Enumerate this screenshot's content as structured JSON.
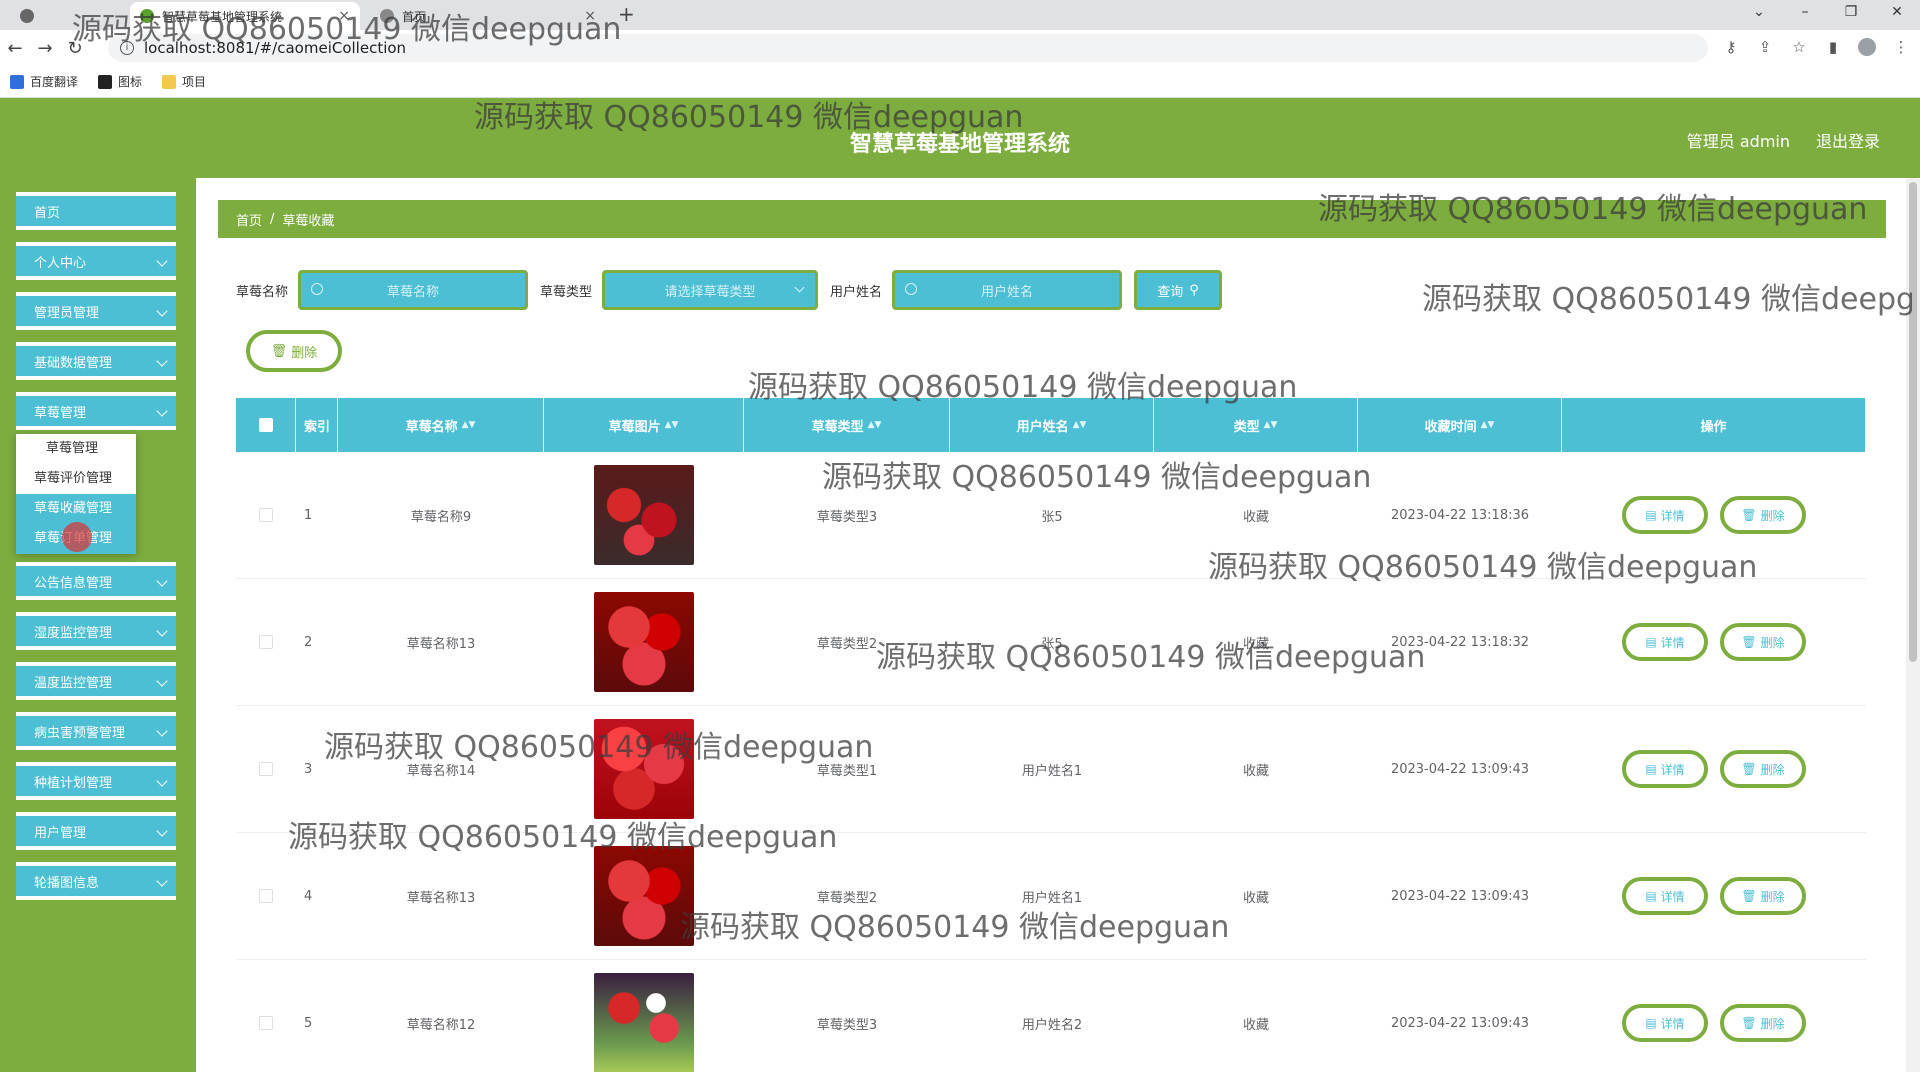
{
  "browser": {
    "tabs": [
      {
        "title": "智慧草莓基地管理系统"
      },
      {
        "title": "首页"
      }
    ],
    "new_tab_label": "+",
    "url": "localhost:8081/#/caomeiCollection",
    "bookmarks": [
      {
        "label": "百度翻译"
      },
      {
        "label": "图标"
      },
      {
        "label": "项目"
      }
    ]
  },
  "header": {
    "title": "智慧草莓基地管理系统",
    "user_label": "管理员 admin",
    "logout_label": "退出登录"
  },
  "sidebar": {
    "items": [
      {
        "label": "首页"
      },
      {
        "label": "个人中心"
      },
      {
        "label": "管理员管理"
      },
      {
        "label": "基础数据管理"
      },
      {
        "label": "草莓管理"
      },
      {
        "label": "公告信息管理"
      },
      {
        "label": "湿度监控管理"
      },
      {
        "label": "温度监控管理"
      },
      {
        "label": "病虫害预警管理"
      },
      {
        "label": "种植计划管理"
      },
      {
        "label": "用户管理"
      },
      {
        "label": "轮播图信息"
      }
    ],
    "submenu": [
      {
        "label": "草莓管理"
      },
      {
        "label": "草莓评价管理"
      },
      {
        "label": "草莓收藏管理"
      },
      {
        "label": "草莓订单管理"
      }
    ]
  },
  "breadcrumb": {
    "home": "首页",
    "separator": "/",
    "current": "草莓收藏"
  },
  "search": {
    "name_label": "草莓名称",
    "name_placeholder": "草莓名称",
    "type_label": "草莓类型",
    "type_placeholder": "请选择草莓类型",
    "user_label": "用户姓名",
    "user_placeholder": "用户姓名",
    "query_label": "查询"
  },
  "toolbar": {
    "delete_label": "删除"
  },
  "table": {
    "columns": [
      "索引",
      "草莓名称",
      "草莓图片",
      "草莓类型",
      "用户姓名",
      "类型",
      "收藏时间",
      "操作"
    ],
    "detail_label": "详情",
    "delete_label": "删除",
    "rows": [
      {
        "index": "1",
        "name": "草莓名称9",
        "type": "草莓类型3",
        "user": "张5",
        "kind": "收藏",
        "time": "2023-04-22 13:18:36"
      },
      {
        "index": "2",
        "name": "草莓名称13",
        "type": "草莓类型2",
        "user": "张5",
        "kind": "收藏",
        "time": "2023-04-22 13:18:32"
      },
      {
        "index": "3",
        "name": "草莓名称14",
        "type": "草莓类型1",
        "user": "用户姓名1",
        "kind": "收藏",
        "time": "2023-04-22 13:09:43"
      },
      {
        "index": "4",
        "name": "草莓名称13",
        "type": "草莓类型2",
        "user": "用户姓名1",
        "kind": "收藏",
        "time": "2023-04-22 13:09:43"
      },
      {
        "index": "5",
        "name": "草莓名称12",
        "type": "草莓类型3",
        "user": "用户姓名2",
        "kind": "收藏",
        "time": "2023-04-22 13:09:43"
      }
    ]
  },
  "watermark": "源码获取 QQ86050149 微信deepguan",
  "colors": {
    "green": "#7dad3f",
    "cyan": "#4cbfd4"
  }
}
